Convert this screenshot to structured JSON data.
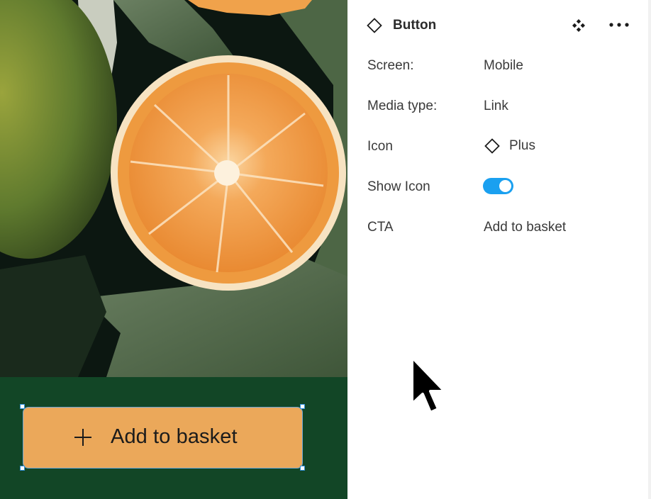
{
  "canvas": {
    "button": {
      "label": "Add to basket",
      "bg_color": "#eba85a",
      "icon": "plus-icon"
    },
    "band_color": "#124626"
  },
  "panel": {
    "header": {
      "icon": "component-diamond-icon",
      "title": "Button",
      "component_icon": "component-set-icon",
      "more_icon": "more-horizontal-icon"
    },
    "rows": [
      {
        "label": "Screen:",
        "value": "Mobile"
      },
      {
        "label": "Media type:",
        "value": "Link"
      },
      {
        "label": "Icon",
        "value": "Plus",
        "icon": "diamond-icon"
      },
      {
        "label": "Show Icon",
        "toggle_on": true,
        "toggle_color": "#1aa0f0"
      },
      {
        "label": "CTA",
        "value": "Add to basket"
      }
    ]
  }
}
